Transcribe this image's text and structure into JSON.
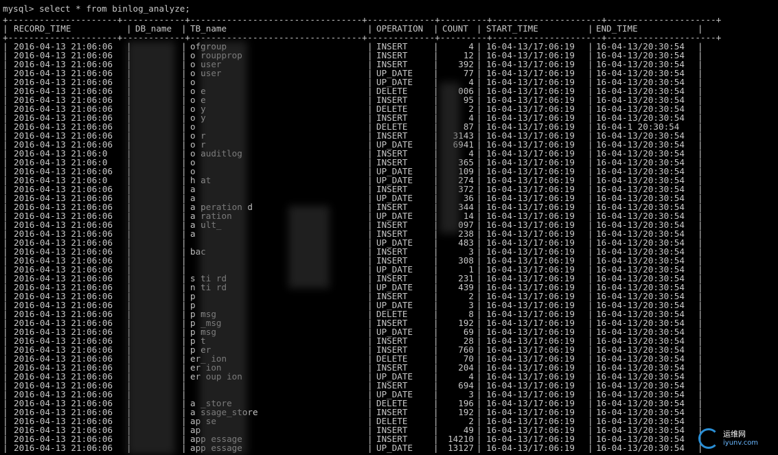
{
  "terminal": {
    "prompt": "mysql> select * from binlog_analyze;",
    "border_line": "+---------------------+------------+---------------------------------+-------------+---------+---------------------+---------------------+"
  },
  "table": {
    "headers": [
      "RECORD_TIME",
      "DB_name",
      "TB_name",
      "OPERATION",
      "COUNT",
      "START_TIME",
      "END_TIME"
    ],
    "rows": [
      [
        "2016-04-13 21:06:06",
        "",
        "ofgroup",
        "INSERT",
        "4",
        "16-04-13/17:06:19",
        "16-04-13/20:30:54"
      ],
      [
        "2016-04-13 21:06:06",
        "",
        "o roupprop",
        "INSERT",
        "12",
        "16-04-13/17:06:19",
        "16-04-13/20:30:54"
      ],
      [
        "2016-04-13 21:06:06",
        "",
        "o user",
        "INSERT",
        "392",
        "16-04-13/17:06:19",
        "16-04-13/20:30:54"
      ],
      [
        "2016-04-13 21:06:06",
        "",
        "o user",
        "UP_DATE",
        "77",
        "16-04-13/17:06:19",
        "16-04-13/20:30:54"
      ],
      [
        "2016-04-13 21:06:06",
        "",
        "o",
        "UP_DATE",
        "4",
        "16-04-13/17:06:19",
        "16-04-13/20:30:54"
      ],
      [
        "2016-04-13 21:06:06",
        "",
        "o e",
        "DELETE",
        "006",
        "16-04-13/17:06:19",
        "16-04-13/20:30:54"
      ],
      [
        "2016-04-13 21:06:06",
        "",
        "o e",
        "INSERT",
        "95",
        "16-04-13/17:06:19",
        "16-04-13/20:30:54"
      ],
      [
        "2016-04-13 21:06:06",
        "",
        "o y",
        "DELETE",
        "2",
        "16-04-13/17:06:19",
        "16-04-13/20:30:54"
      ],
      [
        "2016-04-13 21:06:06",
        "",
        "o y",
        "INSERT",
        "4",
        "16-04-13/17:06:19",
        "16-04-13/20:30:54"
      ],
      [
        "2016-04-13 21:06:06",
        "",
        "o",
        "DELETE",
        "87",
        "16-04-13/17:06:19",
        "16-04-1 20:30:54"
      ],
      [
        "2016-04-13 21:06:06",
        "",
        "o r",
        "INSERT",
        "3143",
        "16-04-13/17:06:19",
        "16-04-13/20:30:54"
      ],
      [
        "2016-04-13 21:06:06",
        "",
        "o r",
        "UP_DATE",
        "6941",
        "16-04-13/17:06:19",
        "16-04-13/20:30:54"
      ],
      [
        "2016-04-13 21:06:0",
        "",
        "o auditlog",
        "INSERT",
        "4",
        "16-04-13/17:06:19",
        "16-04-13/20:30:54"
      ],
      [
        "2016-04-13 21:06:0",
        "",
        "o",
        "INSERT",
        "365",
        "16-04-13/17:06:19",
        "16-04-13/20:30:54"
      ],
      [
        "2016-04-13 21:06:06",
        "",
        "o",
        "UP_DATE",
        "109",
        "16-04-13/17:06:19",
        "16-04-13/20:30:54"
      ],
      [
        "2016-04-13 21:06:0",
        "",
        "h at",
        "UP_DATE",
        "274",
        "16-04-13/17:06:19",
        "16-04-13/20:30:54"
      ],
      [
        "2016-04-13 21:06:06",
        "",
        "a",
        "INSERT",
        "372",
        "16-04-13/17:06:19",
        "16-04-13/20:30:54"
      ],
      [
        "2016-04-13 21:06:06",
        "",
        "a",
        "UP_DATE",
        "36",
        "16-04-13/17:06:19",
        "16-04-13/20:30:54"
      ],
      [
        "2016-04-13 21:06:06",
        "",
        "a peration d",
        "INSERT",
        "344",
        "16-04-13/17:06:19",
        "16-04-13/20:30:54"
      ],
      [
        "2016-04-13 21:06:06",
        "",
        "a ration",
        "UP_DATE",
        "14",
        "16-04-13/17:06:19",
        "16-04-13/20:30:54"
      ],
      [
        "2016-04-13 21:06:06",
        "",
        "a ult_",
        "INSERT",
        "097",
        "16-04-13/17:06:19",
        "16-04-13/20:30:54"
      ],
      [
        "2016-04-13 21:06:06",
        "",
        "a",
        "INSERT",
        "238",
        "16-04-13/17:06:19",
        "16-04-13/20:30:54"
      ],
      [
        "2016-04-13 21:06:06",
        "",
        "",
        "UP_DATE",
        "483",
        "16-04-13/17:06:19",
        "16-04-13/20:30:54"
      ],
      [
        "2016-04-13 21:06:06",
        "",
        "bac",
        "INSERT",
        "3",
        "16-04-13/17:06:19",
        "16-04-13/20:30:54"
      ],
      [
        "2016-04-13 21:06:06",
        "",
        "",
        "INSERT",
        "308",
        "16-04-13/17:06:19",
        "16-04-13/20:30:54"
      ],
      [
        "2016-04-13 21:06:06",
        "",
        "",
        "UP_DATE",
        "1",
        "16-04-13/17:06:19",
        "16-04-13/20:30:54"
      ],
      [
        "2016-04-13 21:06:06",
        "",
        "s ti rd",
        "INSERT",
        "231",
        "16-04-13/17:06:19",
        "16-04-13/20:30:54"
      ],
      [
        "2016-04-13 21:06:06",
        "",
        "n ti rd",
        "UP_DATE",
        "439",
        "16-04-13/17:06:19",
        "16-04-13/20:30:54"
      ],
      [
        "2016-04-13 21:06:06",
        "",
        "p",
        "INSERT",
        "2",
        "16-04-13/17:06:19",
        "16-04-13/20:30:54"
      ],
      [
        "2016-04-13 21:06:06",
        "",
        "p",
        "UP_DATE",
        "3",
        "16-04-13/17:06:19",
        "16-04-13/20:30:54"
      ],
      [
        "2016-04-13 21:06:06",
        "",
        "p msg",
        "DELETE",
        "8",
        "16-04-13/17:06:19",
        "16-04-13/20:30:54"
      ],
      [
        "2016-04-13 21:06:06",
        "",
        "p _msg",
        "INSERT",
        "192",
        "16-04-13/17:06:19",
        "16-04-13/20:30:54"
      ],
      [
        "2016-04-13 21:06:06",
        "",
        "p msg",
        "UP_DATE",
        "69",
        "16-04-13/17:06:19",
        "16-04-13/20:30:54"
      ],
      [
        "2016-04-13 21:06:06",
        "",
        "p t",
        "INSERT",
        "28",
        "16-04-13/17:06:19",
        "16-04-13/20:30:54"
      ],
      [
        "2016-04-13 21:06:06",
        "",
        "p er",
        "INSERT",
        "760",
        "16-04-13/17:06:19",
        "16-04-13/20:30:54"
      ],
      [
        "2016-04-13 21:06:06",
        "",
        "er_ ion",
        "DELETE",
        "70",
        "16-04-13/17:06:19",
        "16-04-13/20:30:54"
      ],
      [
        "2016-04-13 21:06:06",
        "",
        "er ion",
        "INSERT",
        "204",
        "16-04-13/17:06:19",
        "16-04-13/20:30:54"
      ],
      [
        "2016-04-13 21:06:06",
        "",
        "er oup ion",
        "UP_DATE",
        "4",
        "16-04-13/17:06:19",
        "16-04-13/20:30:54"
      ],
      [
        "2016-04-13 21:06:06",
        "",
        "",
        "INSERT",
        "694",
        "16-04-13/17:06:19",
        "16-04-13/20:30:54"
      ],
      [
        "2016-04-13 21:06:06",
        "",
        "",
        "UP_DATE",
        "3",
        "16-04-13/17:06:19",
        "16-04-13/20:30:54"
      ],
      [
        "2016-04-13 21:06:06",
        "",
        "a _store",
        "DELETE",
        "196",
        "16-04-13/17:06:19",
        "16-04-13/20:30:54"
      ],
      [
        "2016-04-13 21:06:06",
        "",
        "a ssage_store",
        "INSERT",
        "192",
        "16-04-13/17:06:19",
        "16-04-13/20:30:54"
      ],
      [
        "2016-04-13 21:06:06",
        "",
        "ap se",
        "DELETE",
        "2",
        "16-04-13/17:06:19",
        "16-04-13/20:30:54"
      ],
      [
        "2016-04-13 21:06:06",
        "",
        "ap",
        "INSERT",
        "49",
        "16-04-13/17:06:19",
        "16-04-13/20:30:54"
      ],
      [
        "2016-04-13 21:06:06",
        "",
        "app essage",
        "INSERT",
        "14210",
        "16-04-13/17:06:19",
        "16-04-13/20:30:54"
      ],
      [
        "2016-04-13 21:06:06",
        "",
        "app essage",
        "UP_DATE",
        "13127",
        "16-04-13/17:06:19",
        "16-04-13/20:30:54"
      ]
    ]
  },
  "watermark": {
    "brand": "运维网",
    "domain": "iyunv.com"
  }
}
